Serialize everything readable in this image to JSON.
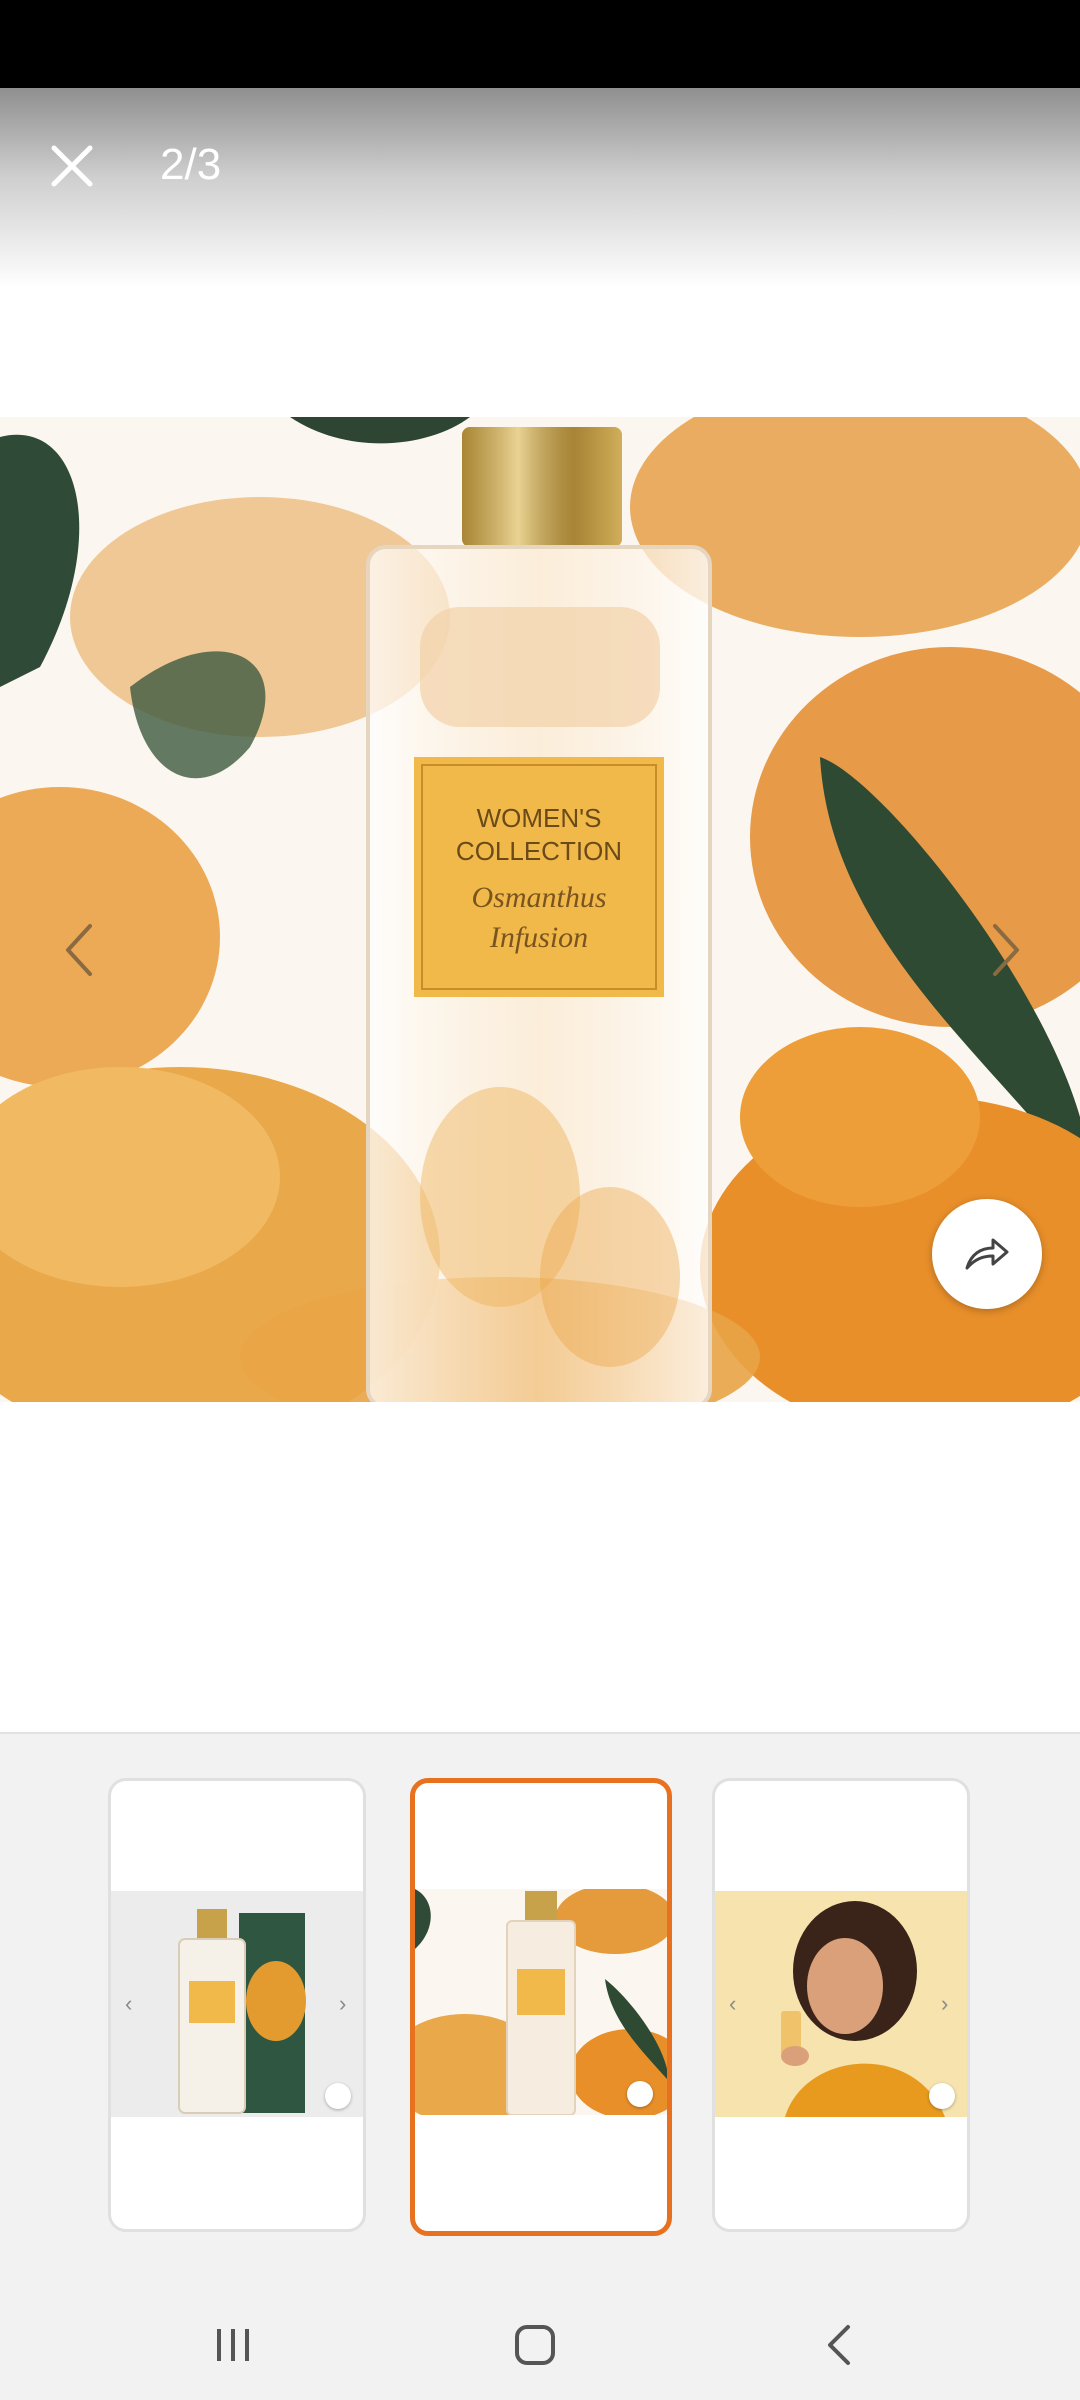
{
  "viewer": {
    "counter": "2/3",
    "close_icon": "close-icon",
    "prev_icon": "chevron-left-icon",
    "next_icon": "chevron-right-icon",
    "share_icon": "share-icon"
  },
  "product_label": {
    "line1": "WOMEN'S",
    "line2": "COLLECTION",
    "script1": "Osmanthus",
    "script2": "Infusion"
  },
  "thumbnails": [
    {
      "name": "thumbnail-1",
      "active": false
    },
    {
      "name": "thumbnail-2",
      "active": true
    },
    {
      "name": "thumbnail-3",
      "active": false
    }
  ],
  "colors": {
    "accent": "#e8711f",
    "label": "#f0b94a",
    "flowers": "#e8962c",
    "cap": "#c8a24a"
  },
  "system_nav": {
    "recents_icon": "recents-icon",
    "home_icon": "home-icon",
    "back_icon": "back-icon"
  }
}
